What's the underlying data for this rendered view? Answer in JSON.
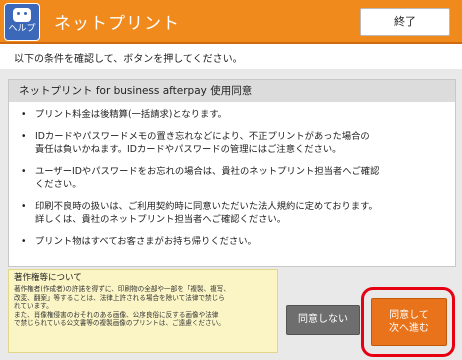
{
  "header": {
    "help_label": "ヘルプ",
    "title": "ネットプリント",
    "end_button": "終了"
  },
  "instruction": "以下の条件を確認して、ボタンを押してください。",
  "agreement": {
    "title": "ネットプリント for business afterpay 使用同意",
    "bullets": [
      {
        "lines": [
          "プリント料金は後精算(一括請求)となります。"
        ]
      },
      {
        "lines": [
          "IDカードやパスワードメモの置き忘れなどにより、不正プリントがあった場合の",
          "責任は負いかねます。IDカードやパスワードの管理にはご注意ください。"
        ]
      },
      {
        "lines": [
          "ユーザーIDやパスワードをお忘れの場合は、貴社のネットプリント担当者へご確認",
          "ください。"
        ]
      },
      {
        "lines": [
          "印刷不良時の扱いは、ご利用契約時に同意いただいた法人規約に定めております。",
          "詳しくは、貴社のネットプリント担当者へご確認ください。"
        ]
      },
      {
        "lines": [
          "プリント物はすべてお客さまがお持ち帰りください。"
        ]
      }
    ]
  },
  "copyright": {
    "title": "著作権等について",
    "lines": [
      "著作権者(作成者)の許諾を得ずに、印刷物の全部や一部を「複製、複写、",
      "改変、翻案」等することは、法律上許される場合を除いて法律で禁じら",
      "れています。",
      "また、肖像権侵害のおそれのある画像、公序良俗に反する画像や法律",
      "で禁じられている公文書等の複製画像のプリントは、ご遠慮ください。"
    ]
  },
  "buttons": {
    "disagree": "同意しない",
    "agree_line1": "同意して",
    "agree_line2": "次へ進む"
  },
  "colors": {
    "header": "#f08a1c",
    "agree_button": "#e8731a",
    "disagree_button": "#6e6e6e",
    "highlight": "#e60012",
    "help_button": "#3b68b8"
  }
}
